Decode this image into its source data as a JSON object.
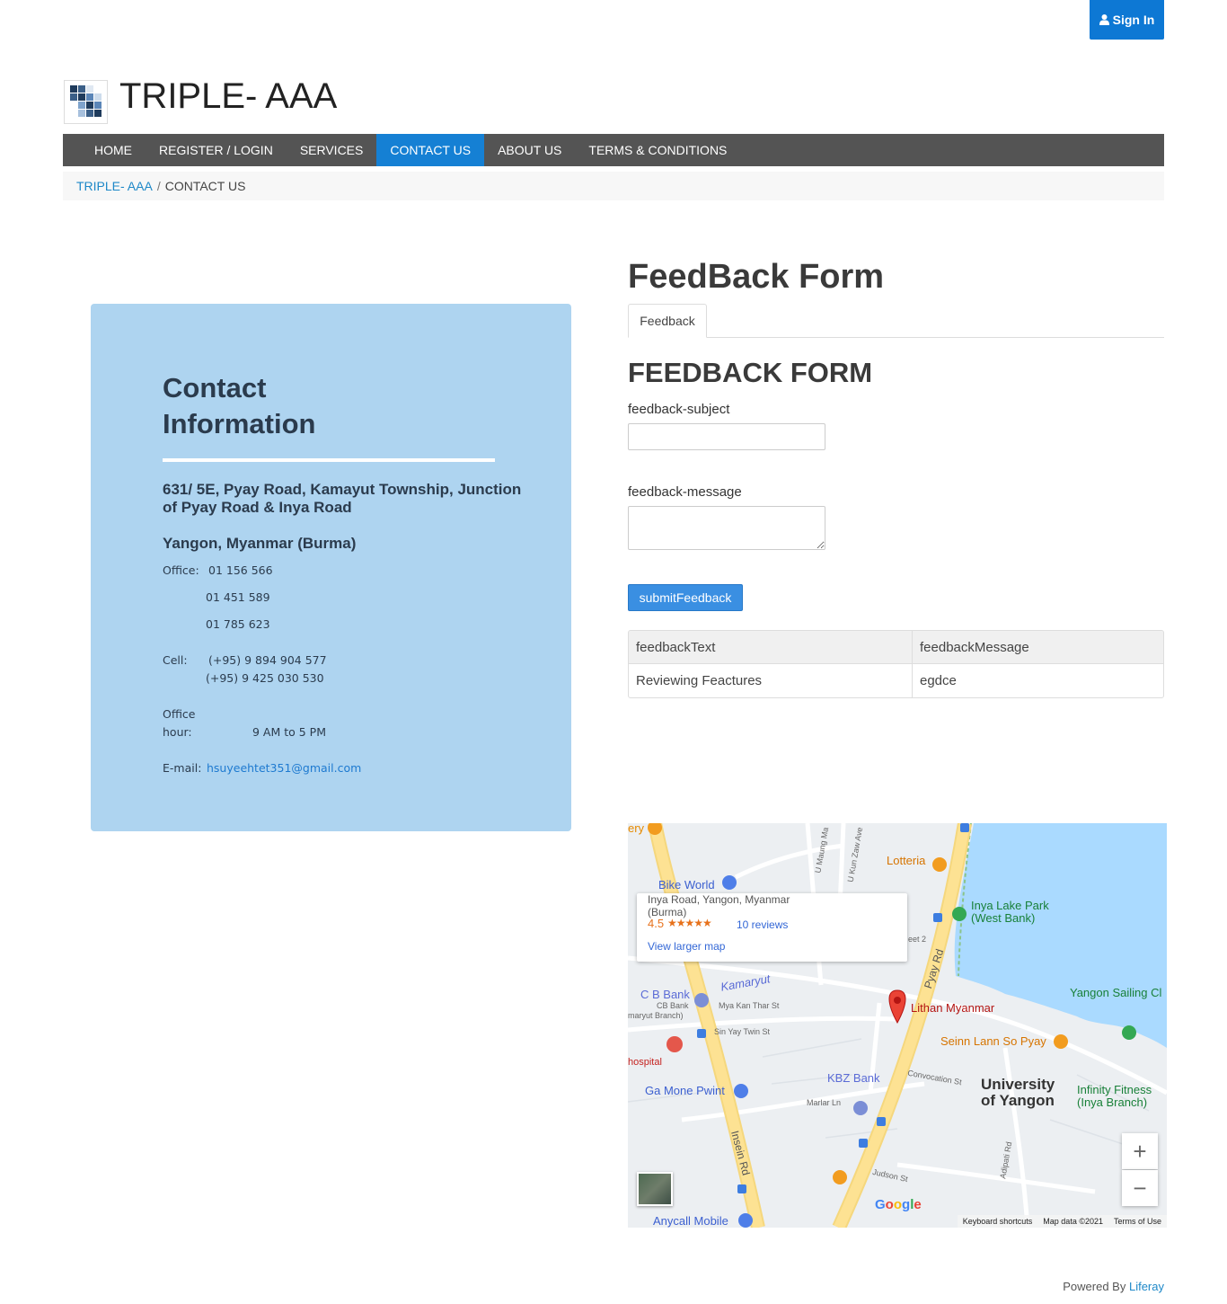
{
  "header": {
    "signin_label": "Sign In",
    "site_title": "TRIPLE- AAA"
  },
  "nav": {
    "items": [
      {
        "label": "HOME"
      },
      {
        "label": "REGISTER / LOGIN"
      },
      {
        "label": "SERVICES"
      },
      {
        "label": "CONTACT US",
        "active": true
      },
      {
        "label": "ABOUT US"
      },
      {
        "label": "TERMS & CONDITIONS"
      }
    ]
  },
  "breadcrumb": {
    "root": "TRIPLE- AAA",
    "separator": "/",
    "current": "CONTACT US"
  },
  "contact": {
    "title": "Contact Information",
    "address_line1": "631/ 5E, Pyay Road, Kamayut Township, Junction of Pyay Road & Inya Road",
    "address_line2": "Yangon, Myanmar (Burma)",
    "office_label": "Office:",
    "office_phones": [
      "01 156 566",
      "01 451 589",
      "01 785 623"
    ],
    "cell_label": "Cell:",
    "cell_phones": [
      "(+95) 9 894 904 577",
      "(+95) 9 425 030 530"
    ],
    "hours_label_1": "Office",
    "hours_label_2": "hour:",
    "hours_value": "9 AM to 5 PM",
    "email_label": "E-mail:",
    "email": "hsuyeehtet351@gmail.com"
  },
  "feedback": {
    "page_title": "FeedBack Form",
    "tab_label": "Feedback",
    "form_heading": "FEEDBACK FORM",
    "subject_label": "feedback-subject",
    "subject_value": "",
    "message_label": "feedback-message",
    "message_value": "",
    "submit_label": "submitFeedback",
    "table": {
      "headers": [
        "feedbackText",
        "feedbackMessage"
      ],
      "rows": [
        [
          "Reviewing Feactures",
          "egdce"
        ]
      ]
    }
  },
  "map": {
    "info_address": "Inya Road, Yangon, Myanmar\n(Burma)",
    "rating": "4.5",
    "stars": "★★★★★",
    "reviews": "10 reviews",
    "view_larger": "View larger map",
    "places": {
      "bike_world": "Bike World",
      "lotteria": "Lotteria",
      "inya_lake_park": "Inya Lake Park (West Bank)",
      "kamaryut": "Kamaryut",
      "cb_bank": "C B Bank",
      "cb_bank_sub": "CB Bank",
      "lithan": "Lithan Myanmar",
      "yangon_sailing": "Yangon Sailing Cl",
      "seinn_lann": "Seinn Lann So Pyay",
      "hospital": "hospital",
      "kbz_bank": "KBZ Bank",
      "ga_mone_pwint": "Ga Mone Pwint",
      "university": "University of Yangon",
      "infinity": "Infinity Fitness (Inya Branch)",
      "anycall": "Anycall Mobile",
      "pyay_rd": "Pyay Rd",
      "insein_rd": "Insein Rd",
      "mya_kan_thar": "Mya Kan Thar St",
      "sin_yay_twin": "Sin Yay Twin St",
      "convocation": "Convocation St",
      "marlar_ln": "Marlar Ln",
      "judson_st": "Judson St",
      "adipati": "Adipati Rd",
      "u_maung": "U Maung Ma",
      "u_kun_zaw": "U Kun Zaw Ave",
      "cb_branch": "maryut Branch)",
      "street2": "eet 2",
      "ery": "ery"
    },
    "zoom_in": "+",
    "zoom_out": "−",
    "google": "Google",
    "footer_shortcuts": "Keyboard shortcuts",
    "footer_data": "Map data ©2021",
    "footer_terms": "Terms of Use"
  },
  "footer": {
    "powered_by": "Powered By",
    "brand": "Liferay"
  },
  "colors": {
    "nav_bg": "#545454",
    "nav_active": "#1580d4",
    "contact_card": "#aed4f0",
    "primary_button": "#3a8fe2",
    "link": "#1e88c8"
  }
}
